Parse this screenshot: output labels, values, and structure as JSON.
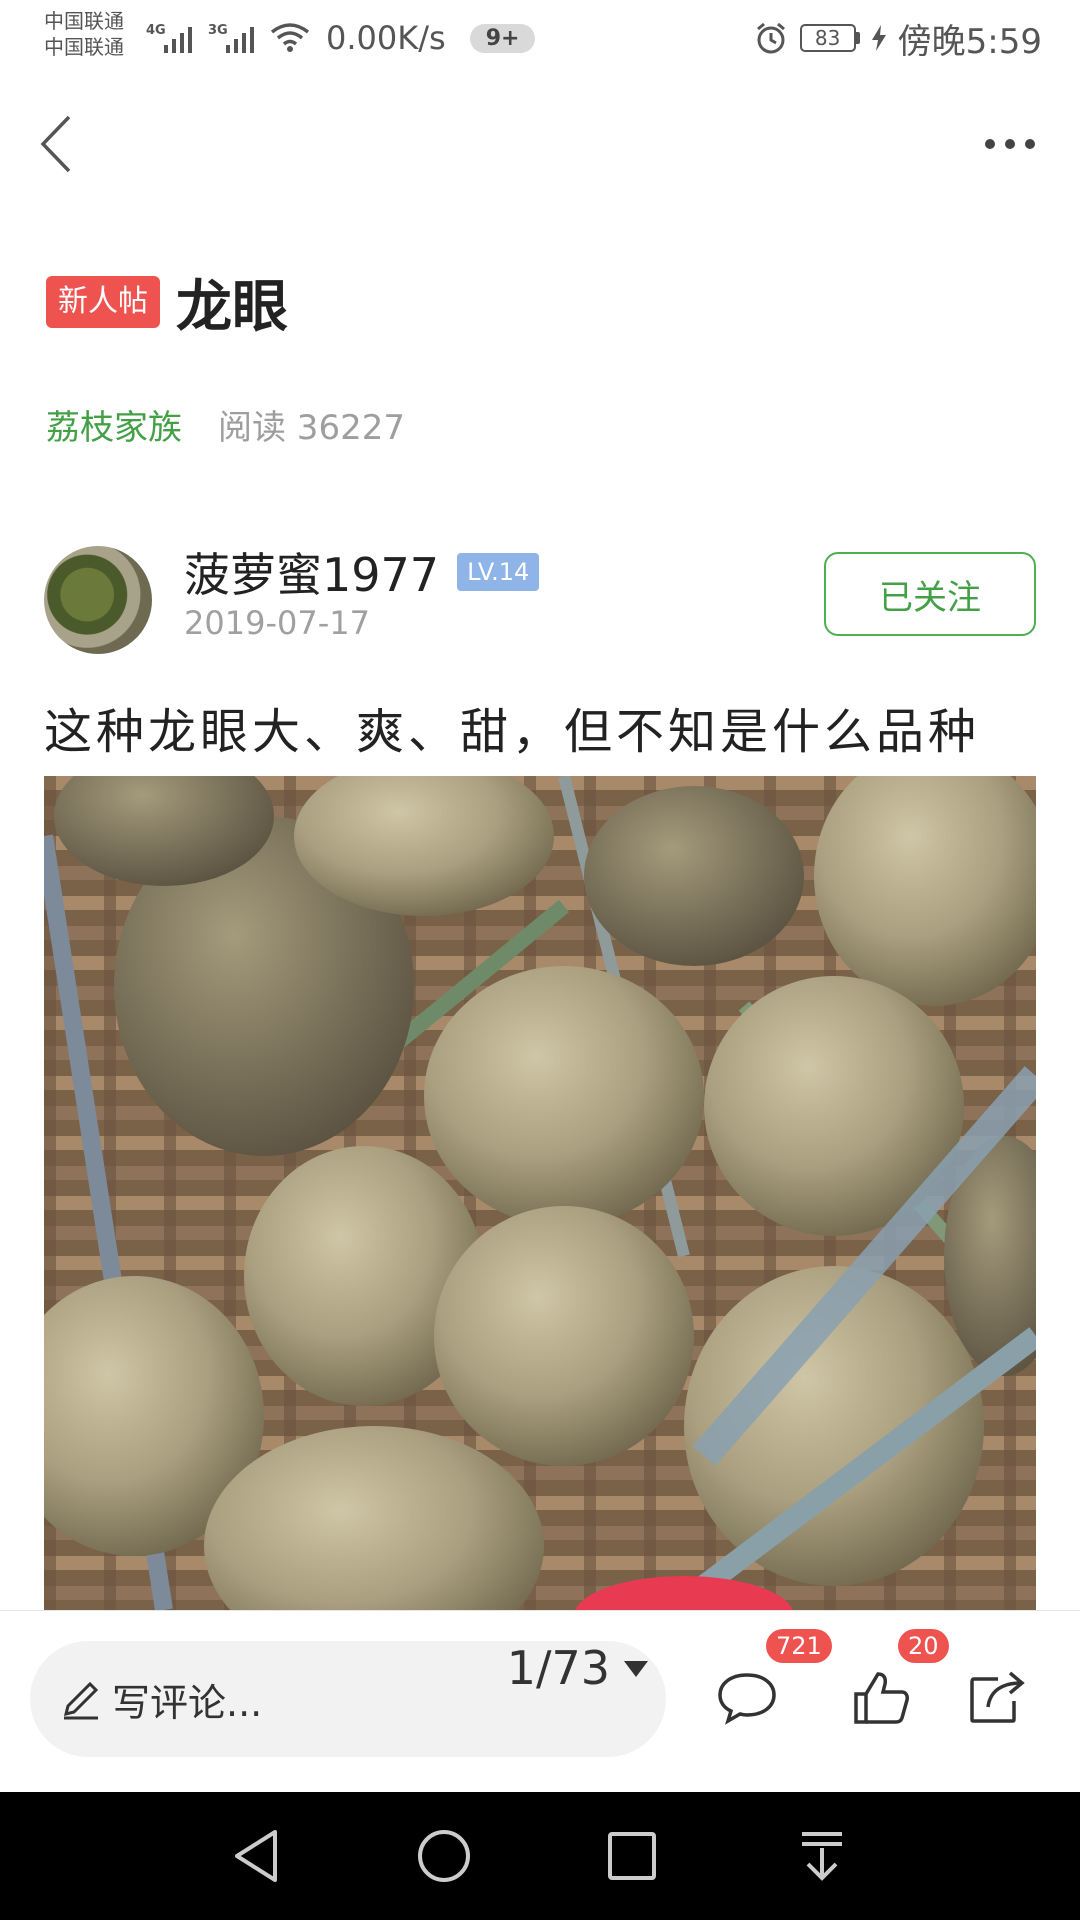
{
  "status_bar": {
    "carrier_1": "中国联通",
    "carrier_2": "中国联通",
    "network_1": "4G",
    "network_2": "3G",
    "net_speed": "0.00K/s",
    "notification_count": "9+",
    "battery_level": "83",
    "time": "傍晚5:59"
  },
  "post": {
    "badge": "新人帖",
    "title": "龙眼",
    "circle": "荔枝家族",
    "reads": "阅读 36227",
    "author": {
      "name": "菠萝蜜1977",
      "level": "LV.14",
      "date": "2019-07-17",
      "follow_label": "已关注"
    },
    "text": "这种龙眼大、爽、甜，但不知是什么品种"
  },
  "action_bar": {
    "comment_placeholder": "写评论...",
    "page_indicator": "1/73",
    "comment_count": "721",
    "like_count": "20"
  },
  "icons": [
    "back-icon",
    "more-icon",
    "pen-icon",
    "comment-icon",
    "like-icon",
    "share-icon",
    "caret-down-icon",
    "nav-back-icon",
    "nav-home-icon",
    "nav-recents-icon",
    "nav-menu-icon"
  ],
  "colors": {
    "accent_green": "#43a047",
    "badge_red": "#ef5350",
    "level_blue": "#8fb4e8"
  }
}
